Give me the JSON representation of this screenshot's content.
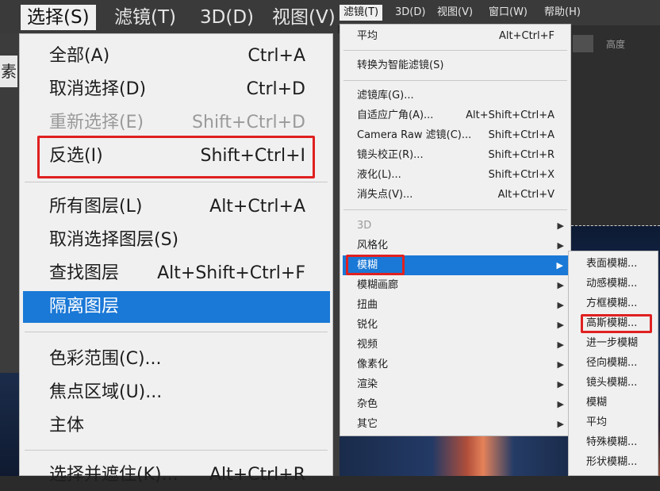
{
  "left_menubar": {
    "items": [
      {
        "label": "选择(S)",
        "active": true
      },
      {
        "label": "滤镜(T)",
        "active": false
      },
      {
        "label": "3D(D)",
        "active": false
      },
      {
        "label": "视图(V)",
        "active": false
      }
    ]
  },
  "left_side_label": "素",
  "select_menu": {
    "items": [
      {
        "label": "全部(A)",
        "shortcut": "Ctrl+A",
        "disabled": false
      },
      {
        "label": "取消选择(D)",
        "shortcut": "Ctrl+D",
        "disabled": false
      },
      {
        "label": "重新选择(E)",
        "shortcut": "Shift+Ctrl+D",
        "disabled": true
      },
      {
        "label": "反选(I)",
        "shortcut": "Shift+Ctrl+I",
        "disabled": false
      },
      {
        "label": "所有图层(L)",
        "shortcut": "Alt+Ctrl+A",
        "disabled": false
      },
      {
        "label": "取消选择图层(S)",
        "shortcut": "",
        "disabled": false
      },
      {
        "label": "查找图层",
        "shortcut": "Alt+Shift+Ctrl+F",
        "disabled": false
      },
      {
        "label": "隔离图层",
        "shortcut": "",
        "disabled": false,
        "highlighted": true
      },
      {
        "label": "色彩范围(C)...",
        "shortcut": "",
        "disabled": false
      },
      {
        "label": "焦点区域(U)...",
        "shortcut": "",
        "disabled": false
      },
      {
        "label": "主体",
        "shortcut": "",
        "disabled": false
      },
      {
        "label": "选择并遮住(K)...",
        "shortcut": "Alt+Ctrl+R",
        "disabled": false
      }
    ]
  },
  "right_menubar": {
    "items": [
      {
        "label": "滤镜(T)",
        "active": true
      },
      {
        "label": "3D(D)",
        "active": false
      },
      {
        "label": "视图(V)",
        "active": false
      },
      {
        "label": "窗口(W)",
        "active": false
      },
      {
        "label": "帮助(H)",
        "active": false
      }
    ],
    "toolbar_text": "高度"
  },
  "filter_menu": {
    "items": [
      {
        "label": "平均",
        "shortcut": "Alt+Ctrl+F"
      },
      {
        "label": "转换为智能滤镜(S)",
        "shortcut": ""
      },
      {
        "label": "滤镜库(G)...",
        "shortcut": ""
      },
      {
        "label": "自适应广角(A)...",
        "shortcut": "Alt+Shift+Ctrl+A"
      },
      {
        "label": "Camera Raw 滤镜(C)...",
        "shortcut": "Shift+Ctrl+A"
      },
      {
        "label": "镜头校正(R)...",
        "shortcut": "Shift+Ctrl+R"
      },
      {
        "label": "液化(L)...",
        "shortcut": "Shift+Ctrl+X"
      },
      {
        "label": "消失点(V)...",
        "shortcut": "Alt+Ctrl+V"
      },
      {
        "label": "3D",
        "submenu": true,
        "disabled": true
      },
      {
        "label": "风格化",
        "submenu": true
      },
      {
        "label": "模糊",
        "submenu": true,
        "highlighted": true
      },
      {
        "label": "模糊画廊",
        "submenu": true
      },
      {
        "label": "扭曲",
        "submenu": true
      },
      {
        "label": "锐化",
        "submenu": true
      },
      {
        "label": "视频",
        "submenu": true
      },
      {
        "label": "像素化",
        "submenu": true
      },
      {
        "label": "渲染",
        "submenu": true
      },
      {
        "label": "杂色",
        "submenu": true
      },
      {
        "label": "其它",
        "submenu": true
      }
    ],
    "submenu_arrow": "▶"
  },
  "blur_submenu": {
    "items": [
      {
        "label": "表面模糊..."
      },
      {
        "label": "动感模糊..."
      },
      {
        "label": "方框模糊..."
      },
      {
        "label": "高斯模糊..."
      },
      {
        "label": "进一步模糊"
      },
      {
        "label": "径向模糊..."
      },
      {
        "label": "镜头模糊..."
      },
      {
        "label": "模糊"
      },
      {
        "label": "平均"
      },
      {
        "label": "特殊模糊..."
      },
      {
        "label": "形状模糊..."
      }
    ]
  },
  "colors": {
    "highlight": "#1a78d6",
    "annotation_red": "#e02020",
    "menu_bg": "#f0f0f0",
    "menubar_bg": "#3a3a3a"
  }
}
